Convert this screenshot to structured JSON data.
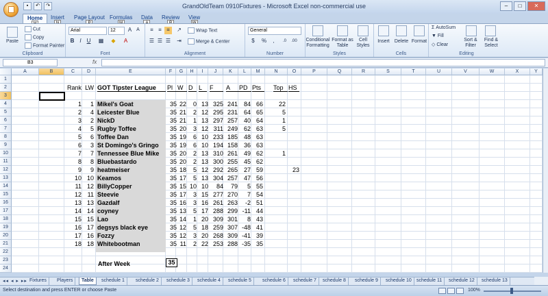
{
  "window": {
    "title": "GrandOldTeam 0910Fixtures - Microsoft Excel non-commercial use"
  },
  "ribbon_tabs": [
    {
      "label": "Home",
      "key": "H"
    },
    {
      "label": "Insert",
      "key": "N"
    },
    {
      "label": "Page Layout",
      "key": "P"
    },
    {
      "label": "Formulas",
      "key": "M"
    },
    {
      "label": "Data",
      "key": "A"
    },
    {
      "label": "Review",
      "key": "R"
    },
    {
      "label": "View",
      "key": "W"
    }
  ],
  "ribbon": {
    "clipboard": {
      "title": "Clipboard",
      "paste": "Paste",
      "cut": "Cut",
      "copy": "Copy",
      "format_painter": "Format Painter"
    },
    "font": {
      "title": "Font",
      "name": "Arial",
      "size": "12"
    },
    "alignment": {
      "title": "Alignment",
      "wrap": "Wrap Text",
      "merge": "Merge & Center"
    },
    "number": {
      "title": "Number",
      "format": "General"
    },
    "styles": {
      "title": "Styles",
      "conditional": "Conditional Formatting",
      "format_table": "Format as Table",
      "cell_styles": "Cell Styles"
    },
    "cells": {
      "title": "Cells",
      "insert": "Insert",
      "delete": "Delete",
      "format": "Format"
    },
    "editing": {
      "title": "Editing",
      "autosum": "AutoSum",
      "fill": "Fill",
      "clear": "Clear",
      "sort": "Sort & Filter",
      "find": "Find & Select"
    }
  },
  "formula_bar": {
    "name_box": "B3",
    "fx": "fx",
    "value": ""
  },
  "columns": [
    "A",
    "B",
    "C",
    "D",
    "E",
    "F",
    "G",
    "H",
    "I",
    "J",
    "K",
    "L",
    "M",
    "N",
    "O",
    "P",
    "Q",
    "R",
    "S",
    "T",
    "U",
    "V",
    "W",
    "X",
    "Y"
  ],
  "rows": [
    "1",
    "2",
    "3",
    "4",
    "5",
    "6",
    "7",
    "8",
    "9",
    "10",
    "11",
    "12",
    "13",
    "14",
    "15",
    "16",
    "17",
    "18",
    "19",
    "20",
    "21",
    "22",
    "23",
    "24"
  ],
  "sheet": {
    "headers": {
      "rank": "Rank",
      "lw": "LW",
      "league": "GOT Tipster League",
      "pl": "Pl",
      "w": "W",
      "d": "D",
      "l": "L",
      "f": "F",
      "a": "A",
      "pd": "PD",
      "pts": "Pts",
      "top": "Top",
      "hs": "HS"
    },
    "table": [
      {
        "rank": "1",
        "lw": "1",
        "name": "Mikel's Goat",
        "pl": "35",
        "w": "22",
        "d": "0",
        "l": "13",
        "f": "325",
        "a": "241",
        "pd": "84",
        "pts": "66",
        "top": "22",
        "hs": ""
      },
      {
        "rank": "2",
        "lw": "4",
        "name": "Leicester Blue",
        "pl": "35",
        "w": "21",
        "d": "2",
        "l": "12",
        "f": "295",
        "a": "231",
        "pd": "64",
        "pts": "65",
        "top": "5",
        "hs": ""
      },
      {
        "rank": "3",
        "lw": "2",
        "name": "NickD",
        "pl": "35",
        "w": "21",
        "d": "1",
        "l": "13",
        "f": "297",
        "a": "257",
        "pd": "40",
        "pts": "64",
        "top": "1",
        "hs": ""
      },
      {
        "rank": "4",
        "lw": "5",
        "name": "Rugby Toffee",
        "pl": "35",
        "w": "20",
        "d": "3",
        "l": "12",
        "f": "311",
        "a": "249",
        "pd": "62",
        "pts": "63",
        "top": "5",
        "hs": ""
      },
      {
        "rank": "5",
        "lw": "6",
        "name": "Toffee Dan",
        "pl": "35",
        "w": "19",
        "d": "6",
        "l": "10",
        "f": "233",
        "a": "185",
        "pd": "48",
        "pts": "63",
        "top": "",
        "hs": ""
      },
      {
        "rank": "6",
        "lw": "3",
        "name": "St Domingo's Gringo",
        "pl": "35",
        "w": "19",
        "d": "6",
        "l": "10",
        "f": "194",
        "a": "158",
        "pd": "36",
        "pts": "63",
        "top": "",
        "hs": ""
      },
      {
        "rank": "7",
        "lw": "7",
        "name": "Tennessee Blue Mike",
        "pl": "35",
        "w": "20",
        "d": "2",
        "l": "13",
        "f": "310",
        "a": "261",
        "pd": "49",
        "pts": "62",
        "top": "1",
        "hs": ""
      },
      {
        "rank": "8",
        "lw": "8",
        "name": "Bluebastardo",
        "pl": "35",
        "w": "20",
        "d": "2",
        "l": "13",
        "f": "300",
        "a": "255",
        "pd": "45",
        "pts": "62",
        "top": "",
        "hs": ""
      },
      {
        "rank": "9",
        "lw": "9",
        "name": "heatmeiser",
        "pl": "35",
        "w": "18",
        "d": "5",
        "l": "12",
        "f": "292",
        "a": "265",
        "pd": "27",
        "pts": "59",
        "top": "",
        "hs": "23"
      },
      {
        "rank": "10",
        "lw": "10",
        "name": "Keamos",
        "pl": "35",
        "w": "17",
        "d": "5",
        "l": "13",
        "f": "304",
        "a": "257",
        "pd": "47",
        "pts": "56",
        "top": "",
        "hs": ""
      },
      {
        "rank": "11",
        "lw": "12",
        "name": "BillyCopper",
        "pl": "35",
        "w": "15",
        "d": "10",
        "l": "10",
        "f": "84",
        "a": "79",
        "pd": "5",
        "pts": "55",
        "top": "",
        "hs": ""
      },
      {
        "rank": "12",
        "lw": "11",
        "name": "Steevie",
        "pl": "35",
        "w": "17",
        "d": "3",
        "l": "15",
        "f": "277",
        "a": "270",
        "pd": "7",
        "pts": "54",
        "top": "",
        "hs": ""
      },
      {
        "rank": "13",
        "lw": "13",
        "name": "Gazdalf",
        "pl": "35",
        "w": "16",
        "d": "3",
        "l": "16",
        "f": "261",
        "a": "263",
        "pd": "-2",
        "pts": "51",
        "top": "",
        "hs": ""
      },
      {
        "rank": "14",
        "lw": "14",
        "name": "coyney",
        "pl": "35",
        "w": "13",
        "d": "5",
        "l": "17",
        "f": "288",
        "a": "299",
        "pd": "-11",
        "pts": "44",
        "top": "",
        "hs": ""
      },
      {
        "rank": "15",
        "lw": "15",
        "name": "Lao",
        "pl": "35",
        "w": "14",
        "d": "1",
        "l": "20",
        "f": "309",
        "a": "301",
        "pd": "8",
        "pts": "43",
        "top": "",
        "hs": ""
      },
      {
        "rank": "16",
        "lw": "17",
        "name": "degsys black eye",
        "pl": "35",
        "w": "12",
        "d": "5",
        "l": "18",
        "f": "259",
        "a": "307",
        "pd": "-48",
        "pts": "41",
        "top": "",
        "hs": ""
      },
      {
        "rank": "17",
        "lw": "16",
        "name": "Fozzy",
        "pl": "35",
        "w": "12",
        "d": "3",
        "l": "20",
        "f": "268",
        "a": "309",
        "pd": "-41",
        "pts": "39",
        "top": "",
        "hs": ""
      },
      {
        "rank": "18",
        "lw": "18",
        "name": "Whitebootman",
        "pl": "35",
        "w": "11",
        "d": "2",
        "l": "22",
        "f": "253",
        "a": "288",
        "pd": "-35",
        "pts": "35",
        "top": "",
        "hs": ""
      }
    ],
    "after_week_label": "After Week",
    "after_week_value": "35"
  },
  "sheet_tabs": [
    "Fixtures",
    "Players",
    "Table",
    "schedule 1",
    "schedule 2",
    "schedule 3",
    "schedule 4",
    "schedule 5",
    "schedule 6",
    "schedule 7",
    "schedule 8",
    "schedule 9",
    "schedule 10",
    "schedule 11",
    "schedule 12",
    "schedule 13"
  ],
  "active_sheet": "Table",
  "status": {
    "message": "Select destination and press ENTER or choose Paste",
    "zoom": "100%"
  }
}
